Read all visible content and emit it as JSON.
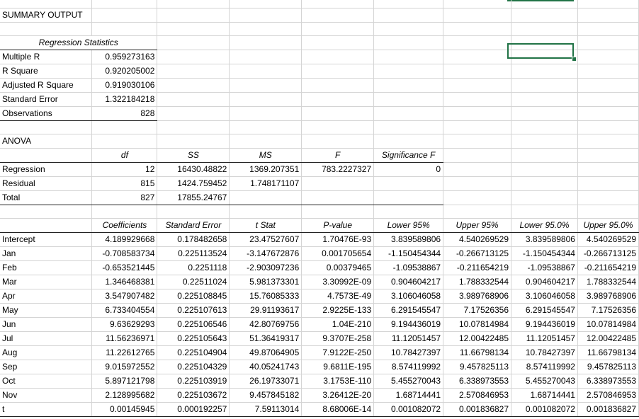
{
  "sheet": {
    "title": "SUMMARY OUTPUT",
    "regression_statistics": {
      "header": "Regression Statistics",
      "rows": [
        {
          "label": "Multiple R",
          "value": "0.959273163"
        },
        {
          "label": "R Square",
          "value": "0.920205002"
        },
        {
          "label": "Adjusted R Square",
          "value": "0.919030106"
        },
        {
          "label": "Standard Error",
          "value": "1.322184218"
        },
        {
          "label": "Observations",
          "value": "828"
        }
      ]
    },
    "anova": {
      "title": "ANOVA",
      "headers": [
        "",
        "df",
        "SS",
        "MS",
        "F",
        "Significance F"
      ],
      "rows": [
        [
          "Regression",
          "12",
          "16430.48822",
          "1369.207351",
          "783.2227327",
          "0"
        ],
        [
          "Residual",
          "815",
          "1424.759452",
          "1.748171107",
          "",
          ""
        ],
        [
          "Total",
          "827",
          "17855.24767",
          "",
          "",
          ""
        ]
      ]
    },
    "coefficients": {
      "headers": [
        "",
        "Coefficients",
        "Standard Error",
        "t Stat",
        "P-value",
        "Lower 95%",
        "Upper 95%",
        "Lower 95.0%",
        "Upper 95.0%"
      ],
      "rows": [
        [
          "Intercept",
          "4.189929668",
          "0.178482658",
          "23.47527607",
          "1.70476E-93",
          "3.839589806",
          "4.540269529",
          "3.839589806",
          "4.540269529"
        ],
        [
          "Jan",
          "-0.708583734",
          "0.225113524",
          "-3.147672876",
          "0.001705654",
          "-1.150454344",
          "-0.266713125",
          "-1.150454344",
          "-0.266713125"
        ],
        [
          "Feb",
          "-0.653521445",
          "0.2251118",
          "-2.903097236",
          "0.00379465",
          "-1.09538867",
          "-0.211654219",
          "-1.09538867",
          "-0.211654219"
        ],
        [
          "Mar",
          "1.346468381",
          "0.22511024",
          "5.981373301",
          "3.30992E-09",
          "0.904604217",
          "1.788332544",
          "0.904604217",
          "1.788332544"
        ],
        [
          "Apr",
          "3.547907482",
          "0.225108845",
          "15.76085333",
          "4.7573E-49",
          "3.106046058",
          "3.989768906",
          "3.106046058",
          "3.989768906"
        ],
        [
          "May",
          "6.733404554",
          "0.225107613",
          "29.91193617",
          "2.9225E-133",
          "6.291545547",
          "7.17526356",
          "6.291545547",
          "7.17526356"
        ],
        [
          "Jun",
          "9.63629293",
          "0.225106546",
          "42.80769756",
          "1.04E-210",
          "9.194436019",
          "10.07814984",
          "9.194436019",
          "10.07814984"
        ],
        [
          "Jul",
          "11.56236971",
          "0.225105643",
          "51.36419317",
          "9.3707E-258",
          "11.12051457",
          "12.00422485",
          "11.12051457",
          "12.00422485"
        ],
        [
          "Aug",
          "11.22612765",
          "0.225104904",
          "49.87064905",
          "7.9122E-250",
          "10.78427397",
          "11.66798134",
          "10.78427397",
          "11.66798134"
        ],
        [
          "Sep",
          "9.015972552",
          "0.225104329",
          "40.05241743",
          "9.6811E-195",
          "8.574119992",
          "9.457825113",
          "8.574119992",
          "9.457825113"
        ],
        [
          "Oct",
          "5.897121798",
          "0.225103919",
          "26.19733071",
          "3.1753E-110",
          "5.455270043",
          "6.338973553",
          "5.455270043",
          "6.338973553"
        ],
        [
          "Nov",
          "2.128995682",
          "0.225103672",
          "9.457845182",
          "3.26412E-20",
          "1.68714441",
          "2.570846953",
          "1.68714441",
          "2.570846953"
        ],
        [
          "t",
          "0.00145945",
          "0.000192257",
          "7.59113014",
          "8.68006E-14",
          "0.001082072",
          "0.001836827",
          "0.001082072",
          "0.001836827"
        ]
      ]
    }
  }
}
